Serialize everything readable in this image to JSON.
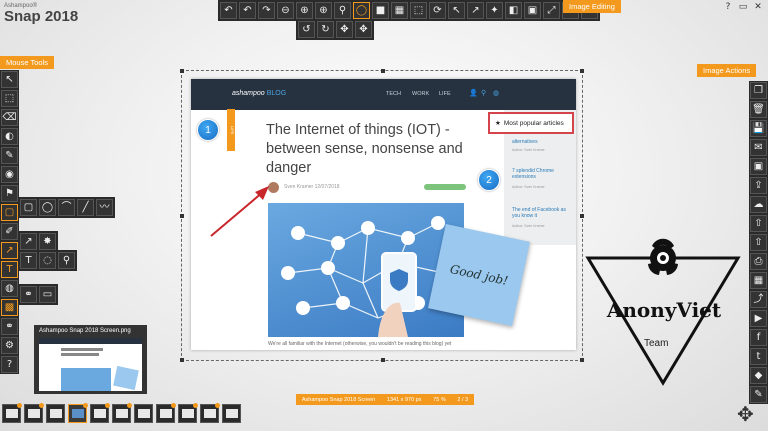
{
  "app": {
    "brand_small": "Ashampoo®",
    "brand_name": "Snap 2018"
  },
  "labels": {
    "mouse_tools": "Mouse Tools",
    "image_editing": "Image Editing",
    "image_actions": "Image Actions"
  },
  "top_toolbar_icons": [
    "undo-icon",
    "undo-icon",
    "redo-icon",
    "zoom-out-icon",
    "zoom-in-icon",
    "zoom-in-icon",
    "search-icon",
    "select-icon",
    "rectangle-icon",
    "grid-icon",
    "resize-icon",
    "rotate-icon",
    "pointer-icon",
    "cursor-icon",
    "magic-icon",
    "color-icon",
    "image-icon",
    "expand-icon",
    "crop-icon",
    "help-icon"
  ],
  "top_toolbar_row2_icons": [
    "rotate-left-icon",
    "rotate-right-icon",
    "move-icon",
    "move-icon"
  ],
  "left_toolbar_icons": [
    "cursor-icon",
    "crop-icon",
    "eraser-icon",
    "highlight-icon",
    "marker-icon",
    "fill-icon",
    "stamp-icon",
    "shape-icon",
    "pen-icon",
    "arrow-icon",
    "text-icon",
    "color-icon",
    "blur-icon",
    "link-icon",
    "settings-icon",
    "help-icon"
  ],
  "shape_tools": [
    "rectangle-icon",
    "ellipse-icon",
    "curve-icon",
    "line-icon",
    "polyline-icon"
  ],
  "arrow_tools": [
    "arrow-icon",
    "spark-icon"
  ],
  "text_tools": [
    "text-icon",
    "speech-bubble-icon",
    "pin-icon"
  ],
  "link_tools": [
    "link-icon",
    "rectangle-icon"
  ],
  "right_toolbar_icons": [
    "copy-icon",
    "delete-icon",
    "save-icon",
    "email-icon",
    "image-icon",
    "export-icon",
    "cloud-icon",
    "upload-icon",
    "upload-icon",
    "print-icon",
    "grid-icon",
    "share-icon",
    "video-icon",
    "facebook-icon",
    "twitter-icon",
    "dropbox-icon",
    "edit-icon"
  ],
  "window_controls": [
    "help-icon",
    "minimize-icon",
    "close-icon"
  ],
  "blog": {
    "logo": "ashampoo",
    "logo_blog": "BLOG",
    "nav": [
      "TECH",
      "WORK",
      "LIFE"
    ],
    "category_tag": "LIFE",
    "title": "The Internet of things (IOT) - between sense, nonsense and danger",
    "author": "Sven Kramer 12/07/2018",
    "caption": "We're all familiar with the Internet (otherwise, you wouldn't be reading this blog) yet",
    "popular_articles": "Most popular articles",
    "sidebar_links": [
      {
        "title": "alternatives",
        "meta": "Author: Sven Kramer"
      },
      {
        "title": "7 splendid Chrome extensions",
        "meta": "Author: Sven Kramer"
      },
      {
        "title": "The end of Facebook as you know it",
        "meta": "Author: Sven Kramer"
      }
    ],
    "marker_1": "1",
    "marker_2": "2",
    "note_text": "Good job!"
  },
  "watermark": {
    "name": "AnonyViet",
    "team": "Team"
  },
  "thumbnail": {
    "name": "Ashampoo Snap 2018 Screen.png"
  },
  "status": {
    "title": "Ashampoo Snap 2018 Screen",
    "dimensions": "1341 x 970 px",
    "zoom": "75 %",
    "position": "2 / 3"
  },
  "filmstrip_count": 11,
  "filmstrip_selected": 3
}
